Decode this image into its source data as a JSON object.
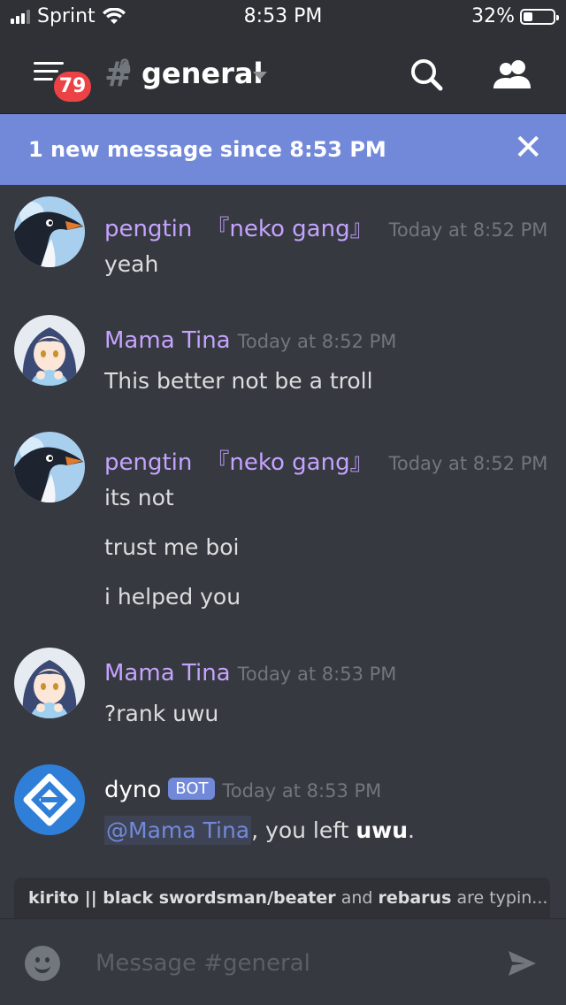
{
  "status_bar": {
    "carrier": "Sprint",
    "time": "8:53 PM",
    "battery_percent": "32%",
    "battery_level": 0.32
  },
  "header": {
    "channel_name": "general",
    "channel_icon": "locked-hash-icon",
    "unread_badge": "79",
    "icons": [
      "menu-icon",
      "search-icon",
      "members-icon"
    ]
  },
  "new_message_bar": {
    "text": "1 new message since 8:53 PM",
    "close_icon": "close-icon"
  },
  "messages": [
    {
      "author": "pengtin",
      "tag": "『neko gang』",
      "timestamp": "Today at 8:52 PM",
      "lines": [
        "yeah"
      ]
    },
    {
      "author": "Mama Tina",
      "timestamp": "Today at 8:52 PM",
      "lines": [
        "This better not be a troll"
      ]
    },
    {
      "author": "pengtin",
      "tag": "『neko gang』",
      "timestamp": "Today at 8:52 PM",
      "lines": [
        "its not",
        "trust me boi",
        "i helped you"
      ]
    },
    {
      "author": "Mama Tina",
      "timestamp": "Today at 8:53 PM",
      "lines": [
        "?rank uwu"
      ]
    },
    {
      "author": "dyno",
      "bot_badge": "BOT",
      "timestamp": "Today at 8:53 PM",
      "mention": "@Mama Tina",
      "text_after_mention": ", you left ",
      "bold_text": "uwu",
      "trailing": "."
    }
  ],
  "typing_indicator": {
    "user1": "kirito || black swordsman/beater",
    "joiner": "and",
    "user2": "rebarus",
    "suffix": "are typin..."
  },
  "composer": {
    "placeholder": "Message #general"
  },
  "colors": {
    "background": "#36393f",
    "header": "#2f3136",
    "blurple": "#7289da",
    "username": "#c5a3ff",
    "badge_red": "#ed4245"
  }
}
